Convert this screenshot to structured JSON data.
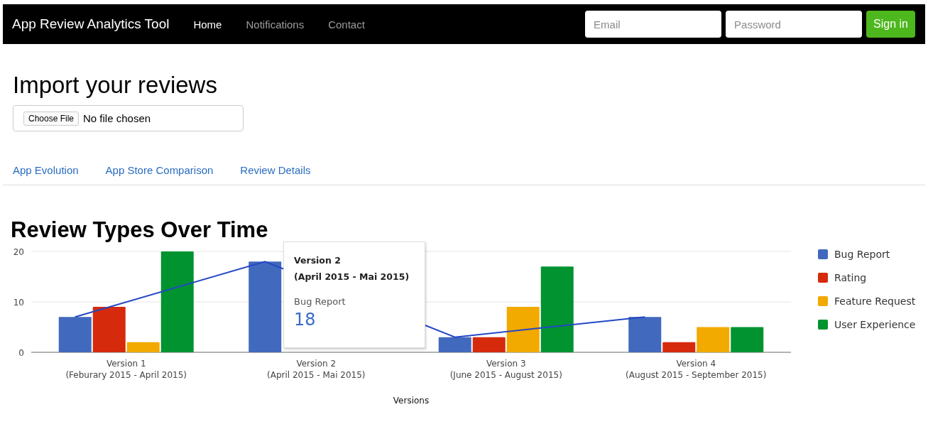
{
  "navbar": {
    "brand": "App Review Analytics Tool",
    "links": [
      {
        "label": "Home",
        "selected": true
      },
      {
        "label": "Notifications",
        "selected": false
      },
      {
        "label": "Contact",
        "selected": false
      }
    ],
    "email": {
      "placeholder": "Email"
    },
    "password": {
      "placeholder": "Password"
    },
    "sign_in": "Sign in"
  },
  "import": {
    "title": "Import your reviews",
    "button": "Choose File",
    "status": "No file chosen"
  },
  "tabs": [
    {
      "label": "App Evolution"
    },
    {
      "label": "App Store Comparison"
    },
    {
      "label": "Review Details"
    }
  ],
  "chart": {
    "title": "Review Types Over Time",
    "tooltip": {
      "title": "Version 2",
      "subtitle": "(April 2015 - Mai 2015)",
      "series": "Bug Report",
      "value": "18"
    },
    "chart_data": {
      "type": "bar",
      "xlabel": "Versions",
      "categories": [
        "Version 1\n(Feburary 2015 - April 2015)",
        "Version 2\n(April 2015 - Mai 2015)",
        "Version 3\n(June 2015 - August 2015)",
        "Version 4\n(August 2015 - September 2015)"
      ],
      "ylim": [
        0,
        20
      ],
      "yticks": [
        0,
        10,
        20
      ],
      "series": [
        {
          "name": "Bug Report",
          "color": "#4169bd",
          "values": [
            7,
            18,
            3,
            7
          ]
        },
        {
          "name": "Rating",
          "color": "#d62a0c",
          "values": [
            9,
            null,
            3,
            2
          ]
        },
        {
          "name": "Feature Request",
          "color": "#f2a900",
          "values": [
            2,
            null,
            9,
            5
          ]
        },
        {
          "name": "User Experience",
          "color": "#029331",
          "values": [
            20,
            null,
            17,
            5
          ]
        }
      ]
    }
  }
}
